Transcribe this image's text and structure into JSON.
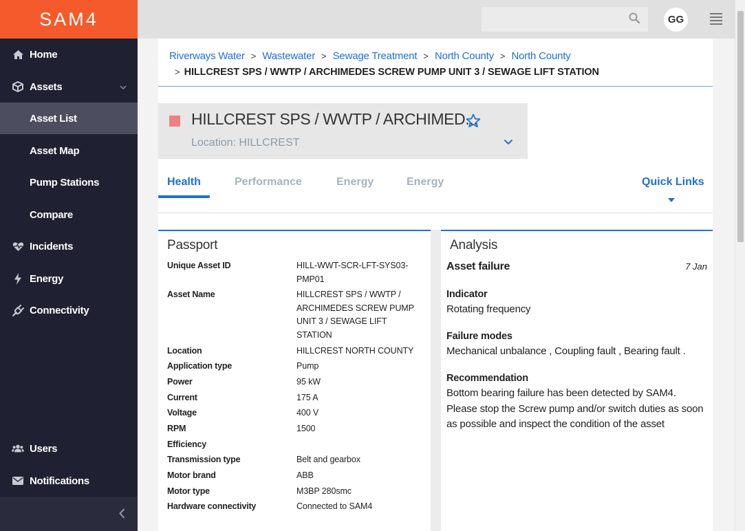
{
  "brand": {
    "name": "SAM4",
    "accent": "#f55a2c",
    "link_color": "#1e6fd9"
  },
  "sidebar": {
    "items": [
      {
        "label": "Home",
        "icon": "home-icon"
      },
      {
        "label": "Assets",
        "icon": "cube-icon"
      },
      {
        "label": "Asset List"
      },
      {
        "label": "Asset Map"
      },
      {
        "label": "Pump Stations"
      },
      {
        "label": "Compare"
      },
      {
        "label": "Incidents",
        "icon": "heartbeat-icon"
      },
      {
        "label": "Energy",
        "icon": "lightning-icon"
      },
      {
        "label": "Connectivity",
        "icon": "plug-icon"
      },
      {
        "label": "Users",
        "icon": "users-icon"
      },
      {
        "label": "Notifications",
        "icon": "envelope-icon"
      }
    ]
  },
  "header": {
    "search_placeholder": "",
    "avatar_initials": "GG"
  },
  "breadcrumb": {
    "links": [
      "Riverways Water",
      "Wastewater",
      "Sewage Treatment",
      "North County",
      "North County"
    ],
    "separator": ">",
    "current": "HILLCREST SPS / WWTP / ARCHIMEDES SCREW PUMP UNIT 3 / SEWAGE LIFT STATION"
  },
  "asset": {
    "title": "HILLCREST SPS / WWTP / ARCHIMED...",
    "location": "Location: HILLCREST",
    "status_color": "#f07f7f"
  },
  "tabs": [
    "Health",
    "Performance",
    "Energy",
    "Energy"
  ],
  "quick_links": "Quick Links",
  "passport": {
    "title": "Passport",
    "rows": [
      {
        "key": "Unique Asset ID",
        "value": "HILL-WWT-SCR-LFT-SYS03-PMP01"
      },
      {
        "key": "Asset Name",
        "value": "HILLCREST SPS / WWTP / ARCHIMEDES SCREW PUMP UNIT 3 / SEWAGE LIFT STATION"
      },
      {
        "key": "Location",
        "value": "HILLCREST NORTH COUNTY"
      },
      {
        "key": "Application type",
        "value": "Pump"
      },
      {
        "key": "Power",
        "value": "95 kW"
      },
      {
        "key": "Current",
        "value": "175 A"
      },
      {
        "key": "Voltage",
        "value": "400 V"
      },
      {
        "key": "RPM",
        "value": "1500"
      },
      {
        "key": "Efficiency",
        "value": ""
      },
      {
        "key": "Transmission type",
        "value": "Belt and gearbox"
      },
      {
        "key": "Motor brand",
        "value": "ABB"
      },
      {
        "key": "Motor type",
        "value": "M3BP 280smc"
      },
      {
        "key": "Hardware connectivity",
        "value": "Connected to SAM4"
      }
    ]
  },
  "analysis": {
    "title": "Analysis",
    "headline": "Asset failure",
    "date": "7 Jan",
    "indicator_label": "Indicator",
    "indicator": "Rotating frequency",
    "failure_modes_label": "Failure modes",
    "failure_modes": "Mechanical unbalance , Coupling fault , Bearing fault .",
    "recommendation_label": "Recommendation",
    "recommendation": "Bottom bearing failure has been detected by SAM4. Please stop the Screw pump and/or switch duties as soon as possible and inspect the condition of the asset"
  }
}
